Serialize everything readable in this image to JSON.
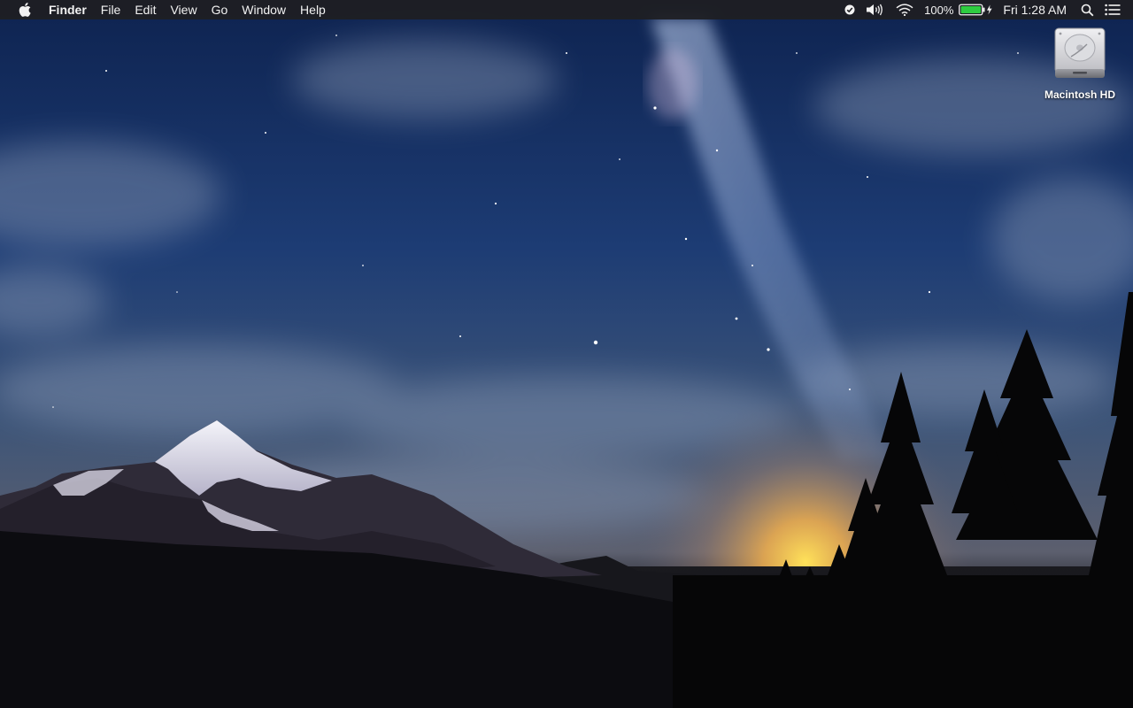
{
  "menubar": {
    "apple_icon": "apple-logo-icon",
    "app_name": "Finder",
    "menus": [
      {
        "label": "File"
      },
      {
        "label": "Edit"
      },
      {
        "label": "View"
      },
      {
        "label": "Go"
      },
      {
        "label": "Window"
      },
      {
        "label": "Help"
      }
    ],
    "status": {
      "sync_icon": "sync-status-icon",
      "volume_icon": "volume-icon",
      "wifi_icon": "wifi-icon",
      "battery_percent": "100%",
      "battery_level": 1.0,
      "battery_icon": "battery-charging-icon",
      "clock": "Fri 1:28 AM",
      "spotlight_icon": "search-icon",
      "notification_icon": "notification-center-icon"
    }
  },
  "desktop": {
    "icons": [
      {
        "label": "Macintosh HD",
        "icon": "hard-drive-icon"
      }
    ]
  },
  "colors": {
    "menubar_bg": "#1e1e22",
    "menubar_text": "#f2f2f2",
    "battery_fill": "#2ecc40"
  }
}
